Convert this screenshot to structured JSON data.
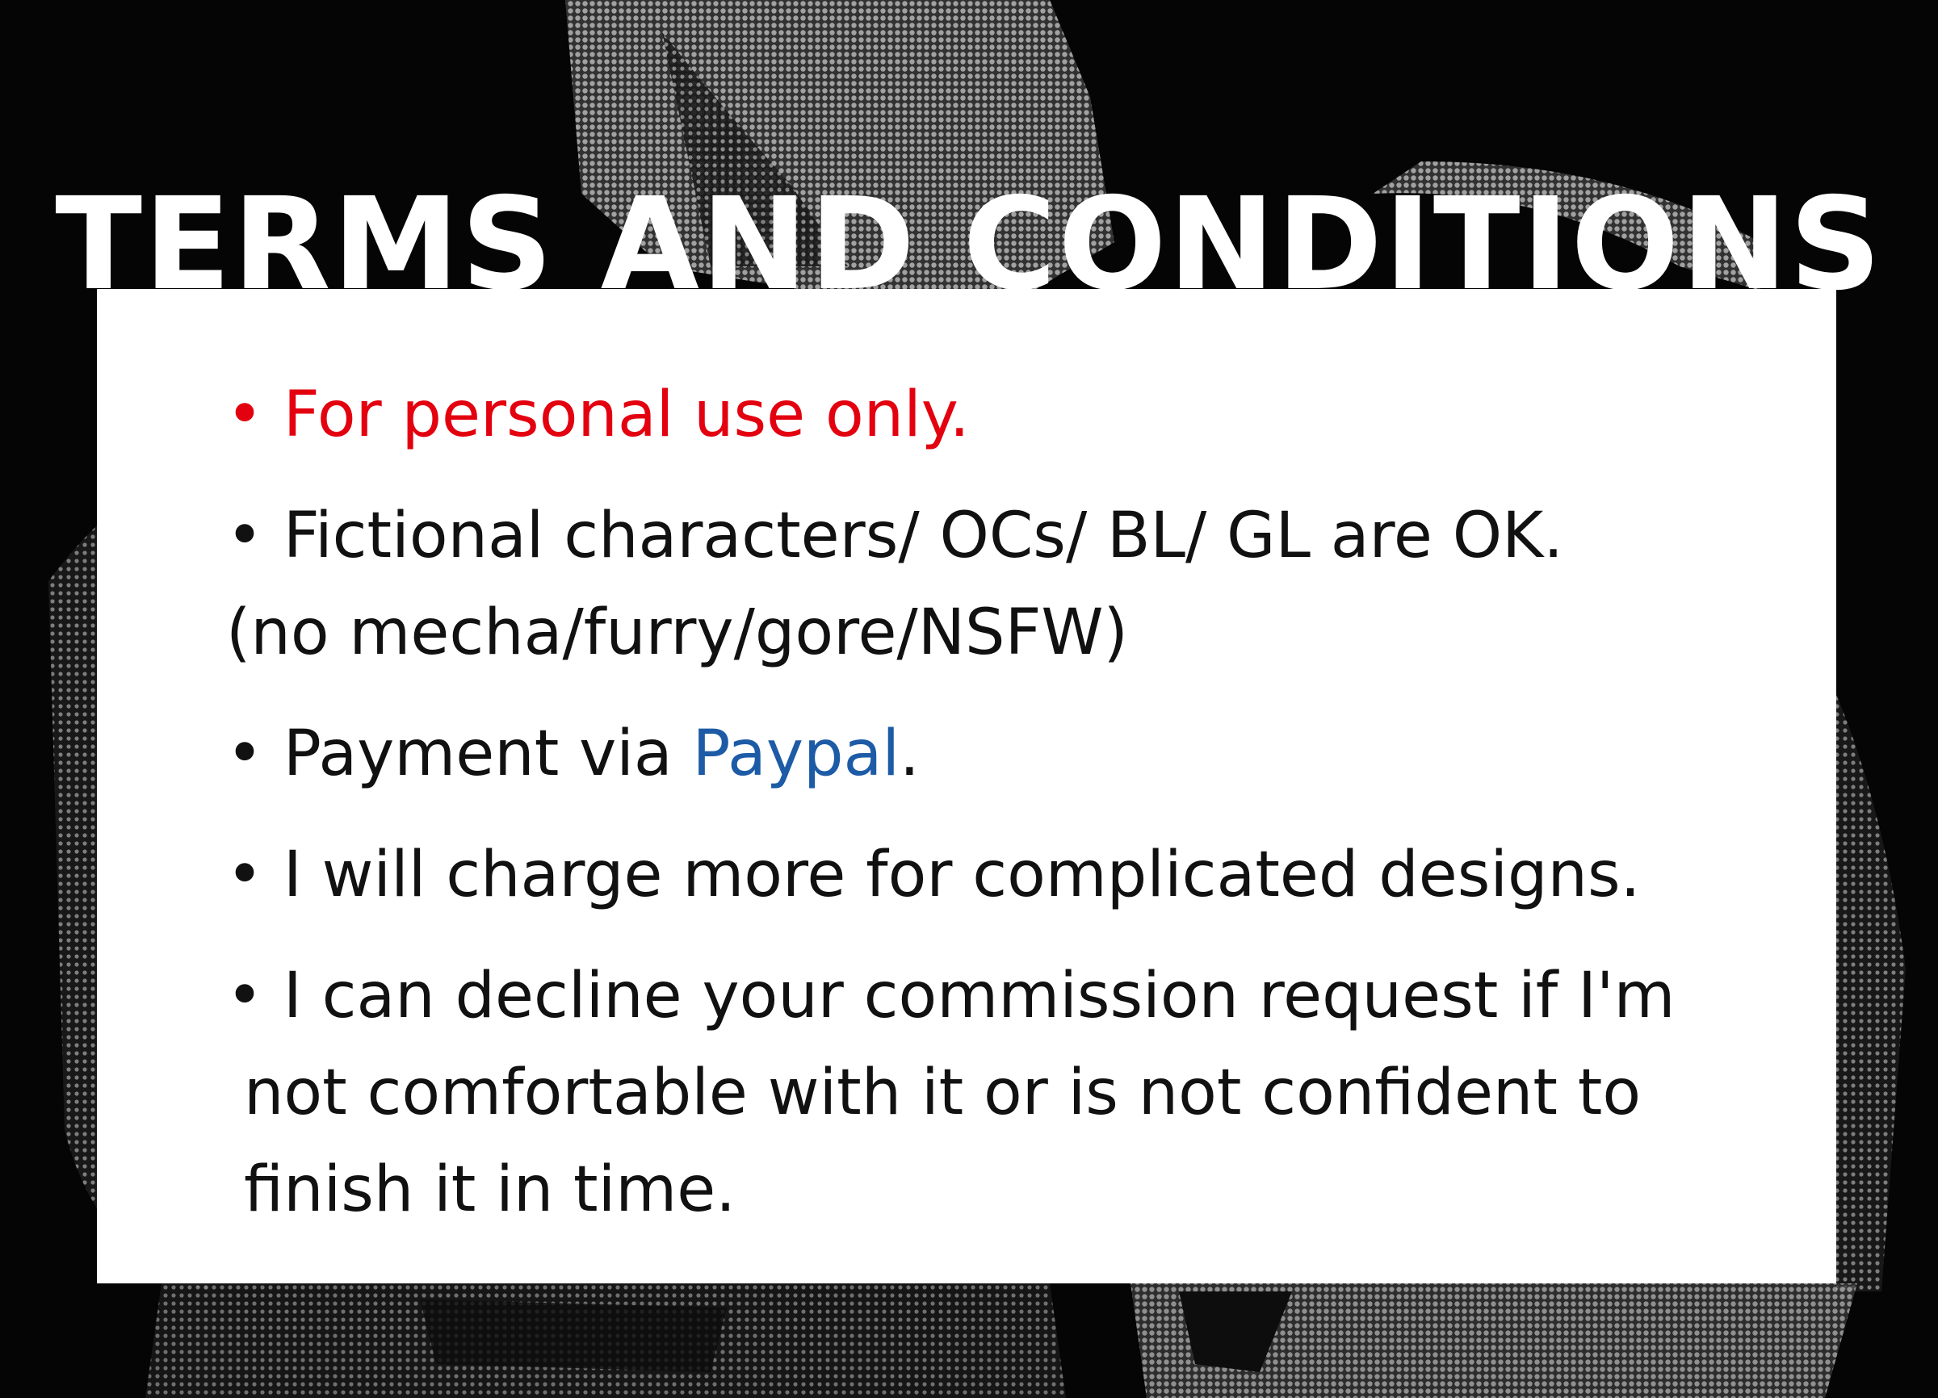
{
  "title": "TERMS AND CONDITIONS",
  "bullet": "•",
  "terms": [
    {
      "text": "For personal use only."
    },
    {
      "line1": "Fictional characters/ OCs/ BL/ GL are OK.",
      "line2": "(no mecha/furry/gore/NSFW)"
    },
    {
      "before": "Payment via ",
      "link": "Paypal",
      "after": "."
    },
    {
      "text": "I will charge more for complicated designs."
    },
    {
      "line1": "I can decline your commission request if I'm",
      "line2": "not comfortable with it or is not confident to",
      "line3": "finish it in time."
    }
  ],
  "colors": {
    "title": "#ffffff",
    "background": "#050505",
    "card": "#ffffff",
    "warning": "#e3000f",
    "link": "#1d5ba6",
    "text": "#111111"
  }
}
